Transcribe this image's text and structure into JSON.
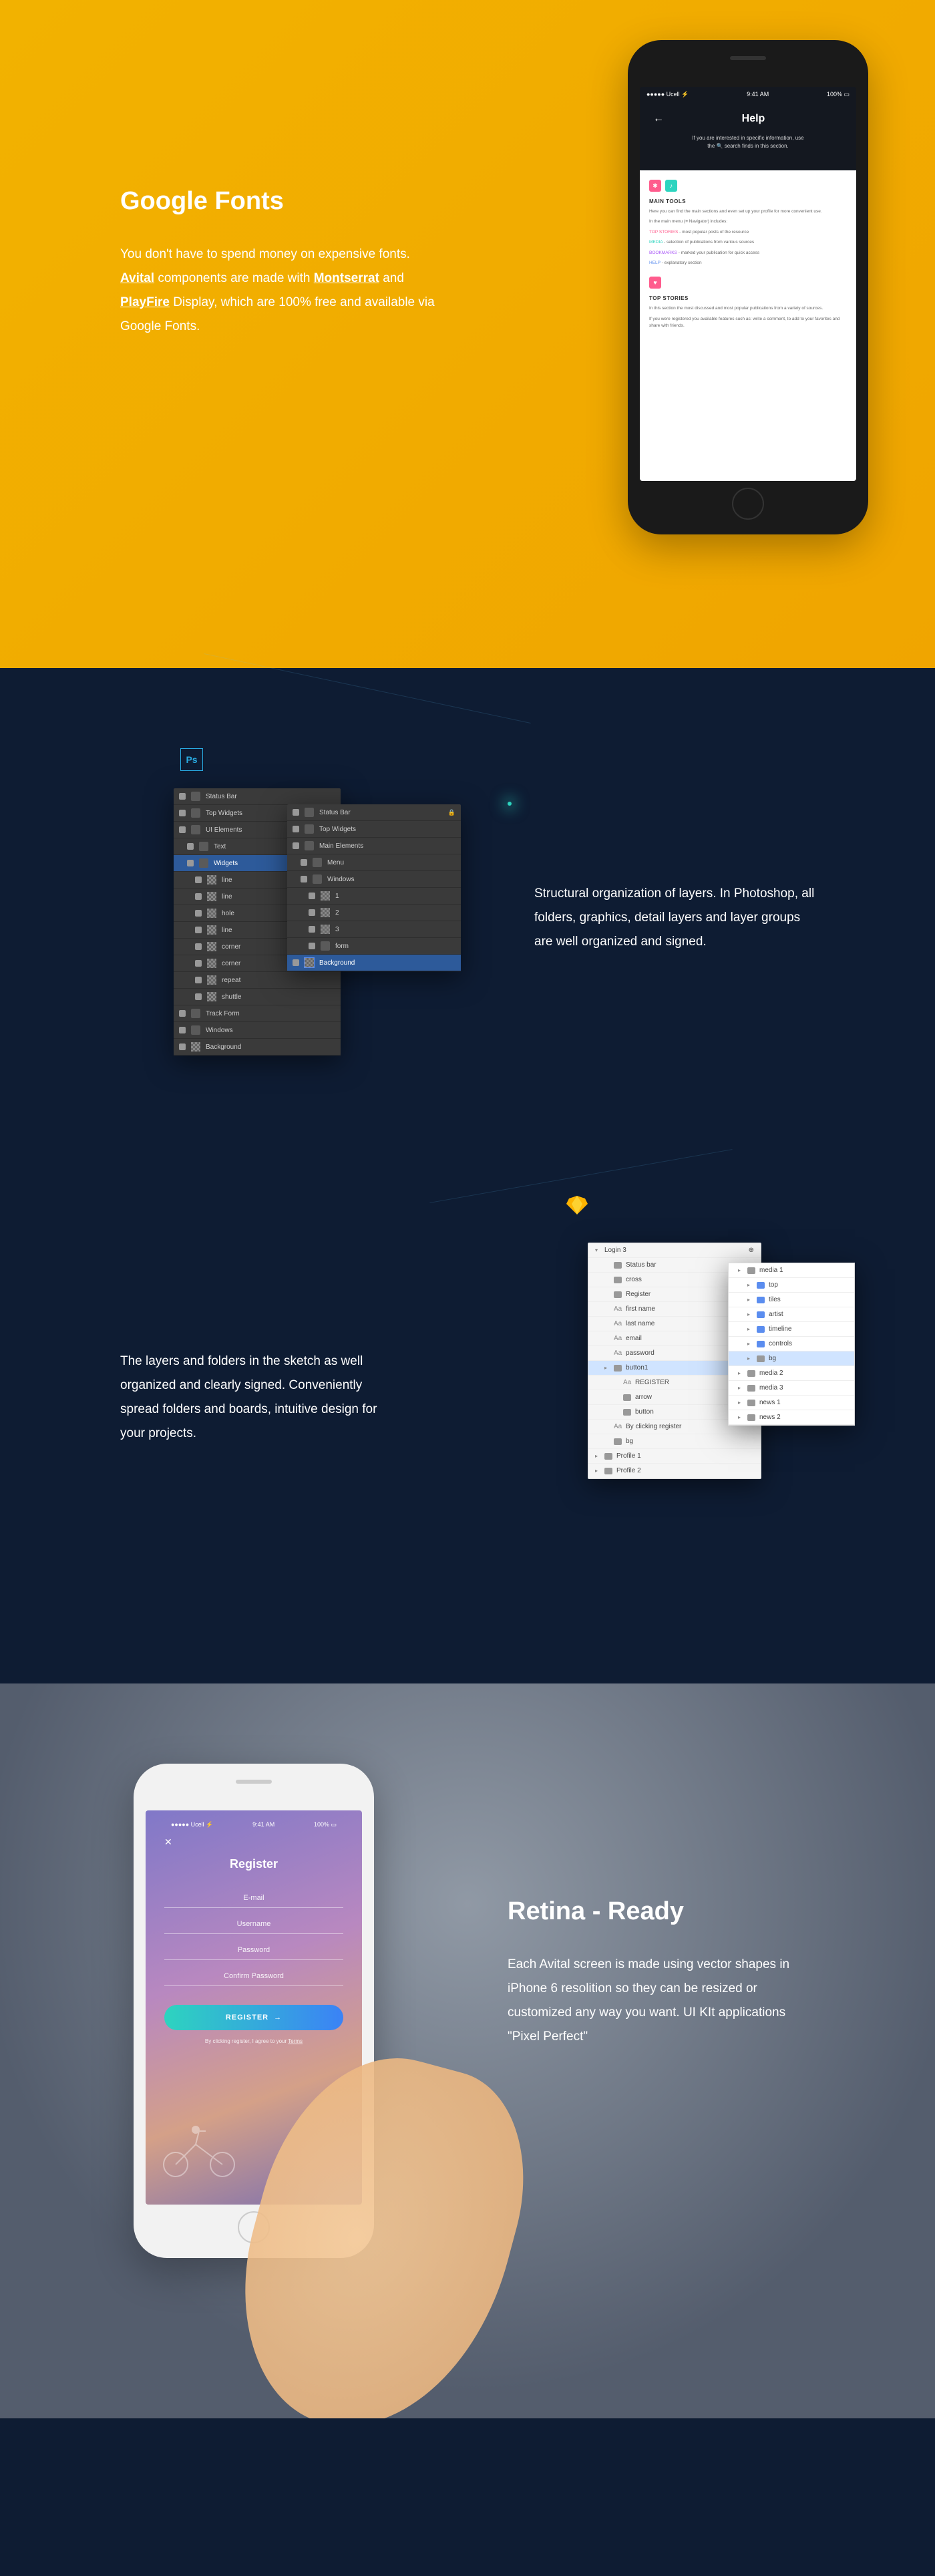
{
  "section1": {
    "title": "Google Fonts",
    "text1": "You don't have to spend money on expensive fonts. ",
    "bold1": "Avital",
    "text2": " components are made with ",
    "bold2": "Montserrat",
    "text3": " and ",
    "bold3": "PlayFire",
    "text4": " Display, which are 100% free and available via Google Fonts."
  },
  "phone1": {
    "statusL": "●●●●● Ucell ⚡",
    "statusC": "9:41 AM",
    "statusR": "100% ▭",
    "back": "←",
    "title": "Help",
    "sub1": "If you are interested in specific information, use",
    "sub2": "the 🔍 search finds in this section.",
    "cardA_title": "MAIN TOOLS",
    "cardA_p1": "Here you can find the main sections and even set up your profile for more convenient use.",
    "cardA_p2": "In the main menu (≡ Navigator) includes:",
    "cardA_k1": "TOP STORIES",
    "cardA_k1t": " - most popular posts of the resource",
    "cardA_k2": "MEDIA",
    "cardA_k2t": " - selection of publications from various sources",
    "cardA_k3": "BOOKMARKS",
    "cardA_k3t": " - marked your publication for quick access",
    "cardA_k4": "HELP",
    "cardA_k4t": " - explanatory section",
    "cardB_title": "TOP STORIES",
    "cardB_p1": "In this section the most discussed and most popular publications from a variety of sources.",
    "cardB_p2": "If you were registered you available features such as: write a comment, to add to your favorites and share with friends."
  },
  "ps": {
    "icon": "Ps",
    "panel1": [
      "Status Bar",
      "Top Widgets",
      "UI Elements",
      "Text",
      "Widgets",
      "line",
      "line",
      "hole",
      "line",
      "corner",
      "corner",
      "repeat",
      "shuttle",
      "Track Form",
      "Windows",
      "Background"
    ],
    "panel2": [
      "Status Bar",
      "Top Widgets",
      "Main Elements",
      "Menu",
      "Windows",
      "1",
      "2",
      "3",
      "form",
      "Background"
    ],
    "text": "Structural organization of layers. In Photoshop, all folders, graphics, detail layers and layer groups are well organized and signed."
  },
  "sk": {
    "text": "The layers and folders in the sketch as well organized and clearly signed. Conveniently spread folders and boards, intuitive design for your projects.",
    "panel1_head": "Login 3",
    "panel1": [
      "Status bar",
      "cross",
      "Register",
      "first name",
      "last name",
      "email",
      "password",
      "button1",
      "REGISTER",
      "arrow",
      "button",
      "By clicking register",
      "bg",
      "Profile 1",
      "Profile 2"
    ],
    "panel2": [
      "media 1",
      "top",
      "tiles",
      "artist",
      "timeline",
      "controls",
      "bg",
      "media 2",
      "media 3",
      "news 1",
      "news 2"
    ]
  },
  "section3": {
    "title": "Retina - Ready",
    "text": "Each Avital screen is made using vector shapes in iPhone 6 resolition so they can be resized or customized any way you want. UI KIt applications \"Pixel Perfect\""
  },
  "phone2": {
    "statusL": "●●●●● Ucell ⚡",
    "statusC": "9:41 AM",
    "statusR": "100% ▭",
    "close": "✕",
    "title": "Register",
    "f1": "E-mail",
    "f2": "Username",
    "f3": "Password",
    "f4": "Confirm Password",
    "btn": "REGISTER",
    "arrow": "→",
    "terms1": "By clicking register, I agree to your ",
    "terms2": "Terms"
  }
}
